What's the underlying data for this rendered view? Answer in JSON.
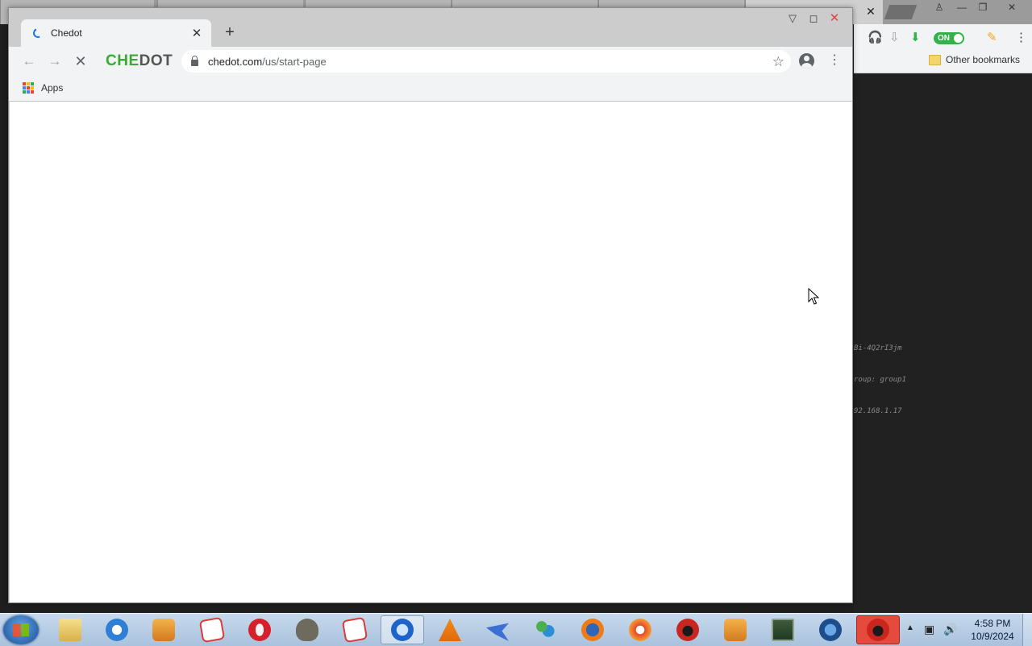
{
  "browser": {
    "tab": {
      "title": "Chedot"
    },
    "logo": {
      "part1": "CHE",
      "part2": "DOT"
    },
    "address": {
      "host": "chedot.com",
      "path": "/us/start-page"
    },
    "bookmarks": {
      "apps_label": "Apps"
    }
  },
  "background_window": {
    "other_bookmarks_label": "Other bookmarks",
    "toggle_label": "ON",
    "console_lines": [
      "Bi-4Q2rI3jm",
      "roup: group1",
      "92.168.1.17"
    ]
  },
  "taskbar": {
    "time": "4:58 PM",
    "date": "10/9/2024",
    "apps": [
      "file-explorer",
      "internet-explorer",
      "media-player",
      "roblox",
      "opera",
      "gimp",
      "roblox-studio",
      "chedot",
      "vlc",
      "shark",
      "messenger",
      "firefox",
      "chromium-based",
      "angry-bird",
      "media-player-2",
      "task-manager",
      "network",
      "angry-bird-active"
    ]
  },
  "colors": {
    "logo_green": "#3aaa35",
    "close_red": "#e0443e",
    "taskbar_active": "#e64a3c"
  }
}
